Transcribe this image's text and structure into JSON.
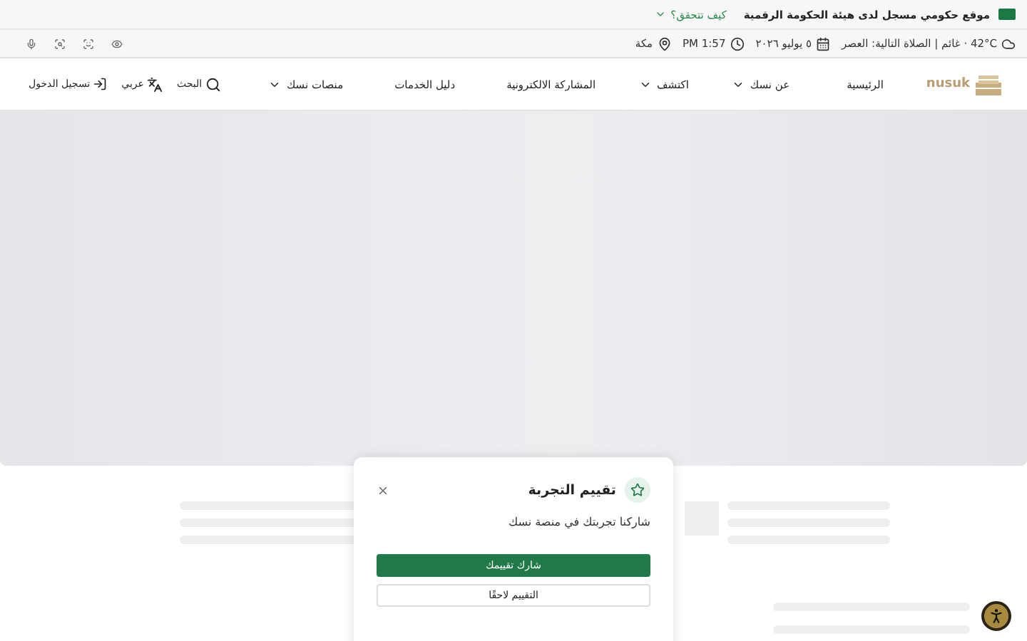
{
  "gov_banner": {
    "text": "موقع حكومي مسجل لدى هيئة الحكومة الرقمية",
    "link": "كيف تتحقق؟",
    "expanded": false
  },
  "info_bar": {
    "weather": "42°C · غائم | الصلاة التالية: العصر",
    "date": "٥ يوليو ٢٠٢٦",
    "time": "PM 1:57",
    "location": "مكة"
  },
  "nav": {
    "logo": "nusuk",
    "items": [
      {
        "label": "الرئيسية",
        "dropdown": false
      },
      {
        "label": "عن نسك",
        "dropdown": true
      },
      {
        "label": "اكتشف",
        "dropdown": true
      },
      {
        "label": "المشاركة الالكترونية",
        "dropdown": false
      },
      {
        "label": "دليل الخدمات",
        "dropdown": false
      },
      {
        "label": "منصات نسك",
        "dropdown": true
      }
    ],
    "search": "البحث",
    "language": "عربي",
    "login": "تسجيل الدخول"
  },
  "dialog": {
    "title": "تقييم التجربة",
    "message": "شاركنا تجربتك في منصة نسك",
    "primary": "شارك تقييمك",
    "secondary": "التقييم لاحقًا"
  }
}
